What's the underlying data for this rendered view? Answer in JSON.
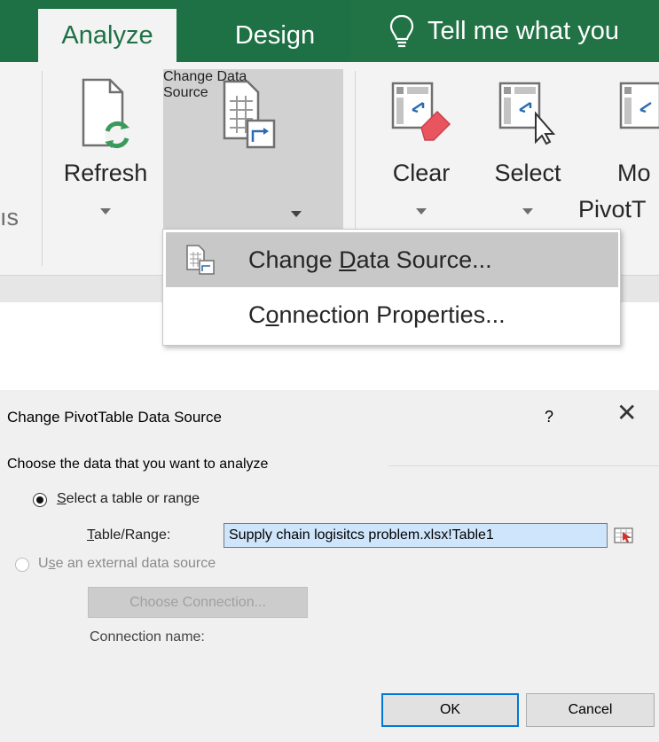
{
  "ribbon": {
    "tabs": {
      "analyze": "Analyze",
      "design": "Design",
      "tell_me": "Tell me what you"
    },
    "left_group_fragment": "ıs",
    "buttons": {
      "refresh": "Refresh",
      "change_line1": "Change Data",
      "change_line2": "Source",
      "clear": "Clear",
      "select": "Select",
      "move_line1": "Mo",
      "move_line2": "PivotT"
    }
  },
  "menu": {
    "change_pre": "Change ",
    "change_ul": "D",
    "change_post": "ata Source...",
    "conn_pre": "C",
    "conn_ul": "o",
    "conn_post": "nnection Properties..."
  },
  "dialog": {
    "title": "Change PivotTable Data Source",
    "help": "?",
    "close": "✕",
    "legend": "Choose the data that you want to analyze",
    "opt1_ul": "S",
    "opt1_rest": "elect a table or range",
    "range_label_ul": "T",
    "range_label_rest": "able/Range:",
    "range_value": "Supply chain logisitcs problem.xlsx!Table1",
    "opt2_pre": "U",
    "opt2_ul": "s",
    "opt2_rest": "e an external data source",
    "choose_btn": "Choose Connection...",
    "conn_name_label": "Connection name:",
    "ok": "OK",
    "cancel": "Cancel"
  },
  "colors": {
    "ribbon_green": "#1e7145",
    "highlight": "#d1d1d1",
    "input_selection": "#cfe5fb",
    "default_button_border": "#0078d7"
  }
}
